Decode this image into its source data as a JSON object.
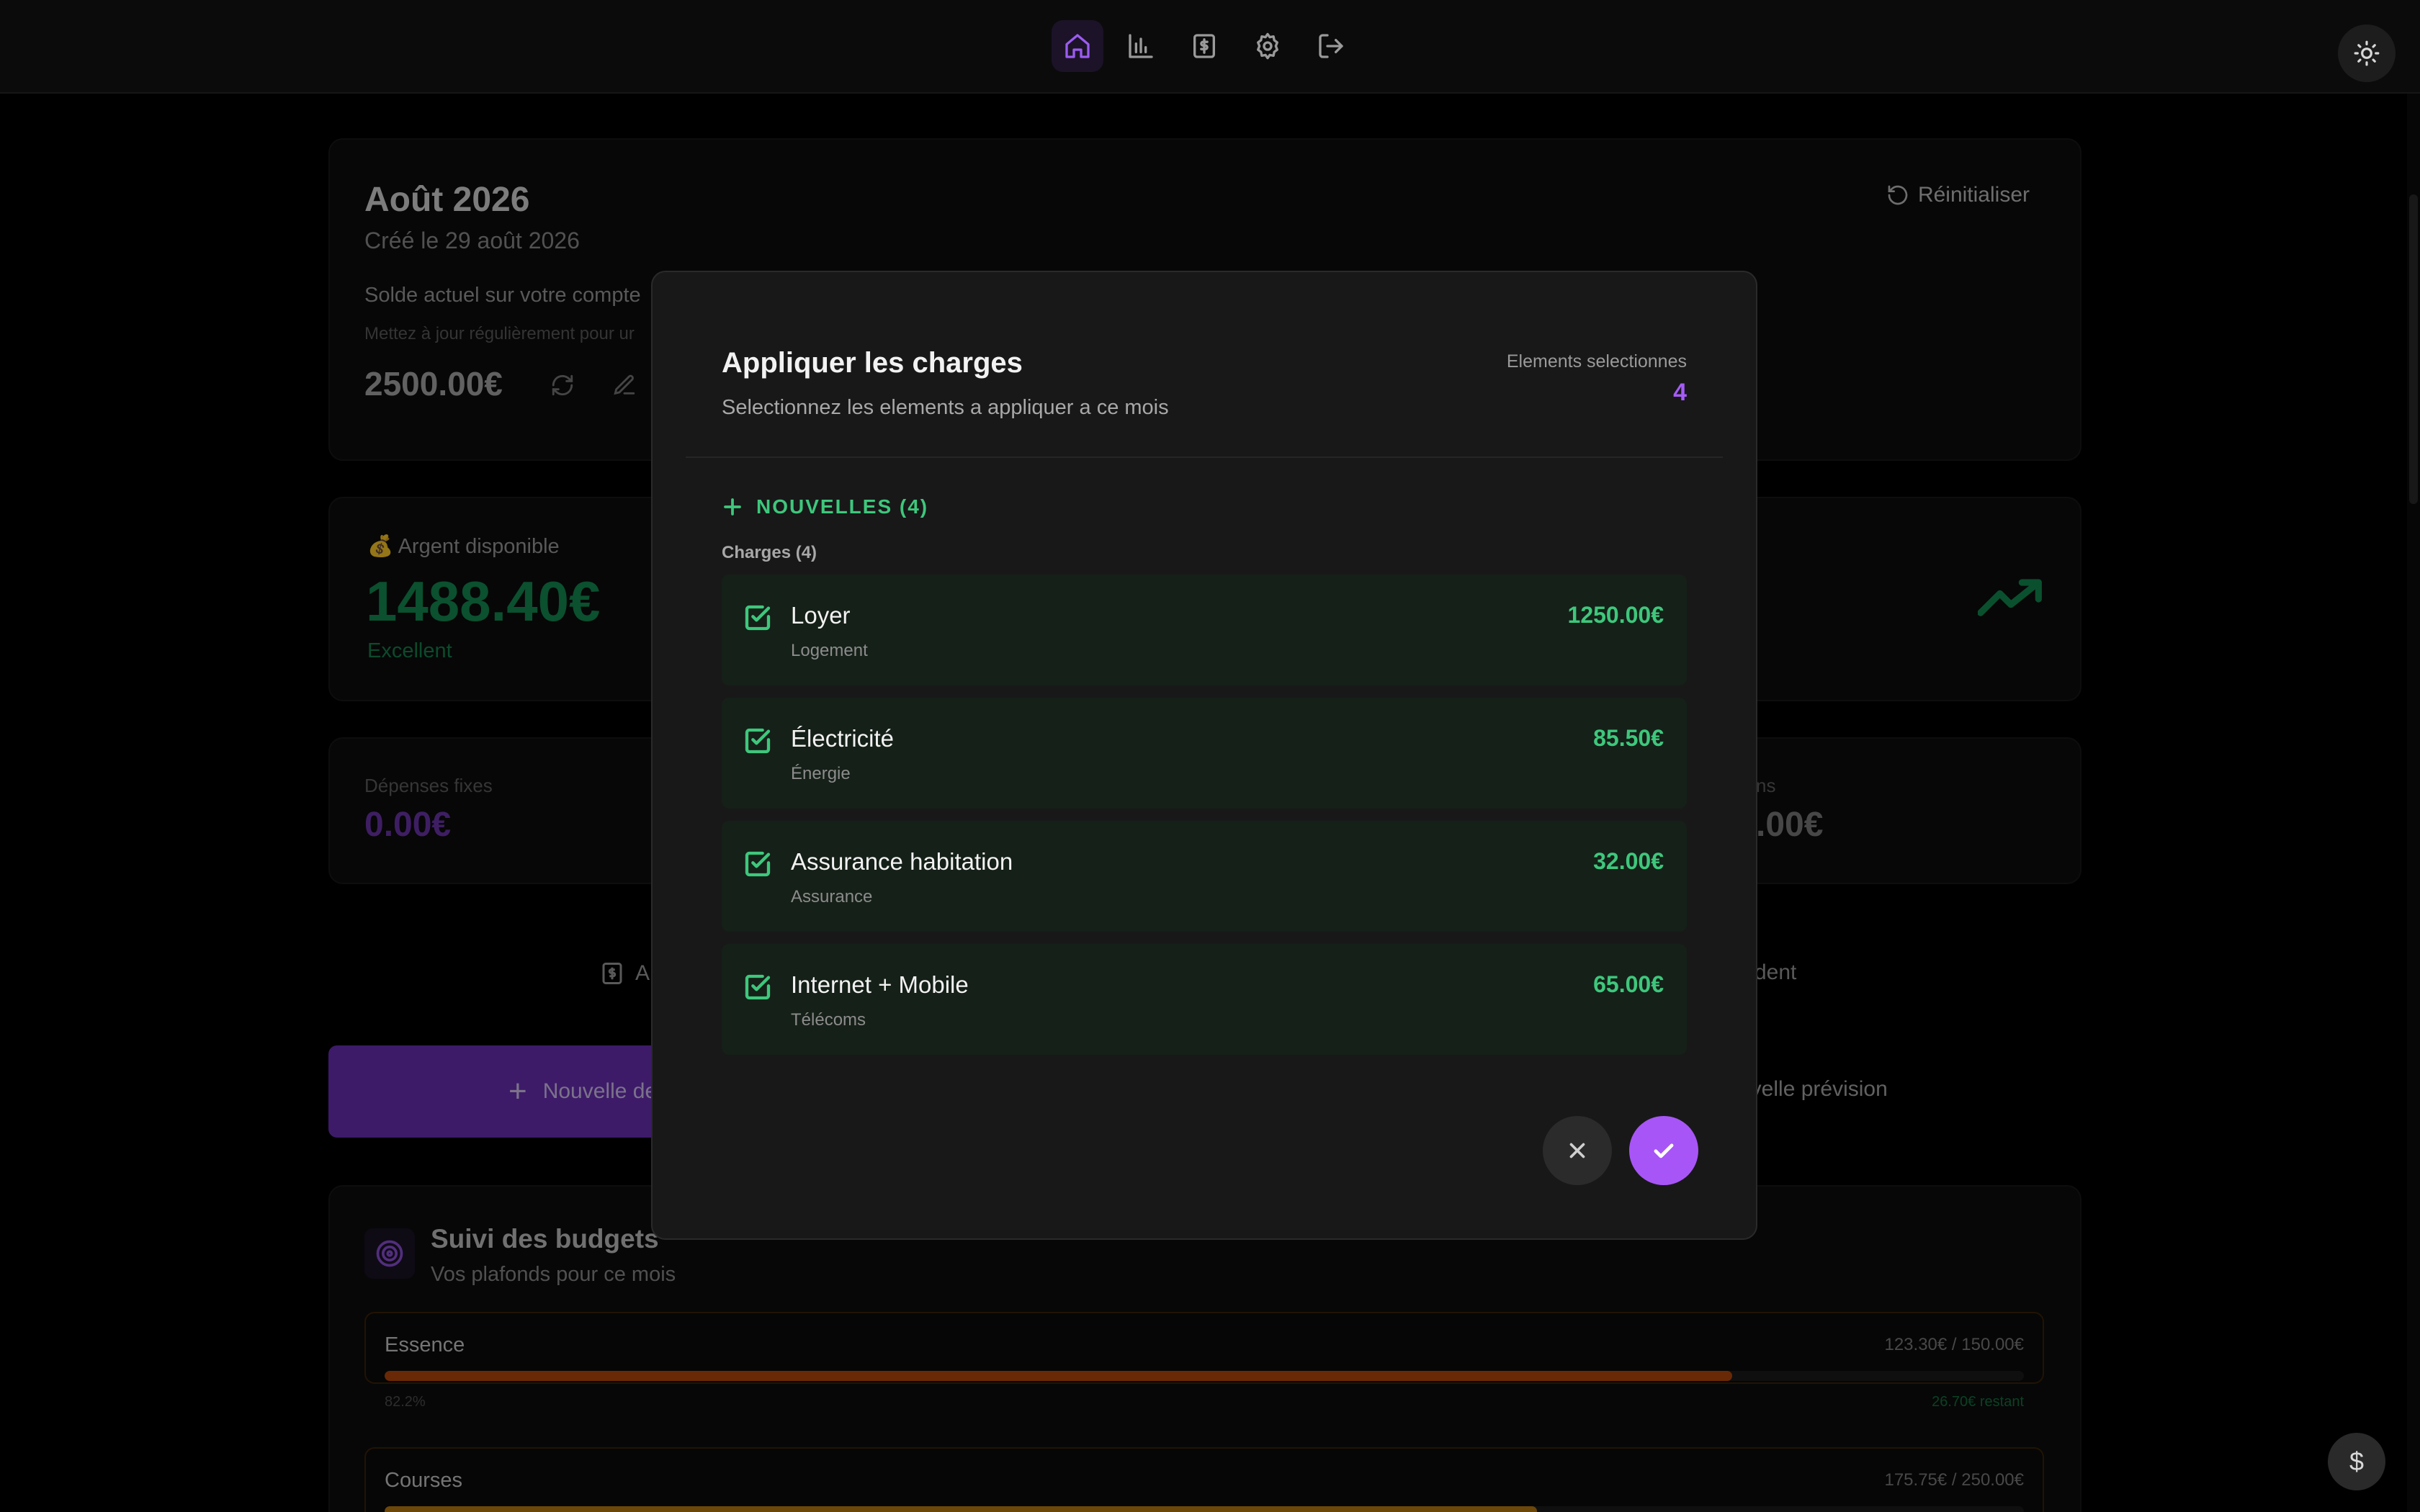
{
  "nav": {
    "items": [
      {
        "name": "home",
        "icon": "home-icon",
        "active": true
      },
      {
        "name": "stats",
        "icon": "bar-chart-icon"
      },
      {
        "name": "budget",
        "icon": "dollar-receipt-icon"
      },
      {
        "name": "settings",
        "icon": "gear-icon"
      },
      {
        "name": "logout",
        "icon": "logout-icon"
      }
    ],
    "theme_icon": "sun-icon"
  },
  "month_card": {
    "title": "Août 2026",
    "created": "Créé le 29 août 2026",
    "reset_label": "Réinitialiser",
    "balance_label": "Solde actuel sur votre compte",
    "balance_hint": "Mettez à jour régulièrement pour ur",
    "balance_value": "2500.00€"
  },
  "available": {
    "label": "💰 Argent disponible",
    "value": "1488.40€",
    "status": "Excellent"
  },
  "fixed": {
    "label": "Dépenses fixes",
    "value": "0.00€"
  },
  "right_stat": {
    "label": "ns",
    "value": ".00€"
  },
  "tabs": {
    "left_partial": "A",
    "right_partial": "dent"
  },
  "actions": {
    "new_expense_partial": "Nouvelle de",
    "new_forecast_partial": "uvelle prévision"
  },
  "budgets": {
    "title": "Suivi des budgets",
    "subtitle": "Vos plafonds pour ce mois",
    "items": [
      {
        "name": "Essence",
        "spent_of_limit": "123.30€ / 150.00€",
        "percent_label": "82.2%",
        "remaining": "26.70€ restant",
        "fraction": 0.822,
        "color": "#b6470c"
      },
      {
        "name": "Courses",
        "spent_of_limit": "175.75€ / 250.00€",
        "fraction": 0.703,
        "color": "#b87b10"
      }
    ]
  },
  "modal": {
    "title": "Appliquer les charges",
    "subtitle": "Selectionnez les elements a appliquer a ce mois",
    "selected_label": "Elements selectionnes",
    "selected_count": "4",
    "section": "NOUVELLES (4)",
    "group_label": "Charges (4)",
    "items": [
      {
        "name": "Loyer",
        "category": "Logement",
        "amount": "1250.00€",
        "checked": true
      },
      {
        "name": "Électricité",
        "category": "Énergie",
        "amount": "85.50€",
        "checked": true
      },
      {
        "name": "Assurance habitation",
        "category": "Assurance",
        "amount": "32.00€",
        "checked": true
      },
      {
        "name": "Internet + Mobile",
        "category": "Télécoms",
        "amount": "65.00€",
        "checked": true
      }
    ],
    "colors": {
      "accent": "#a855f7",
      "positive": "#3ec77c"
    }
  },
  "fab": {
    "symbol": "$",
    "icon": "dollar-icon"
  }
}
